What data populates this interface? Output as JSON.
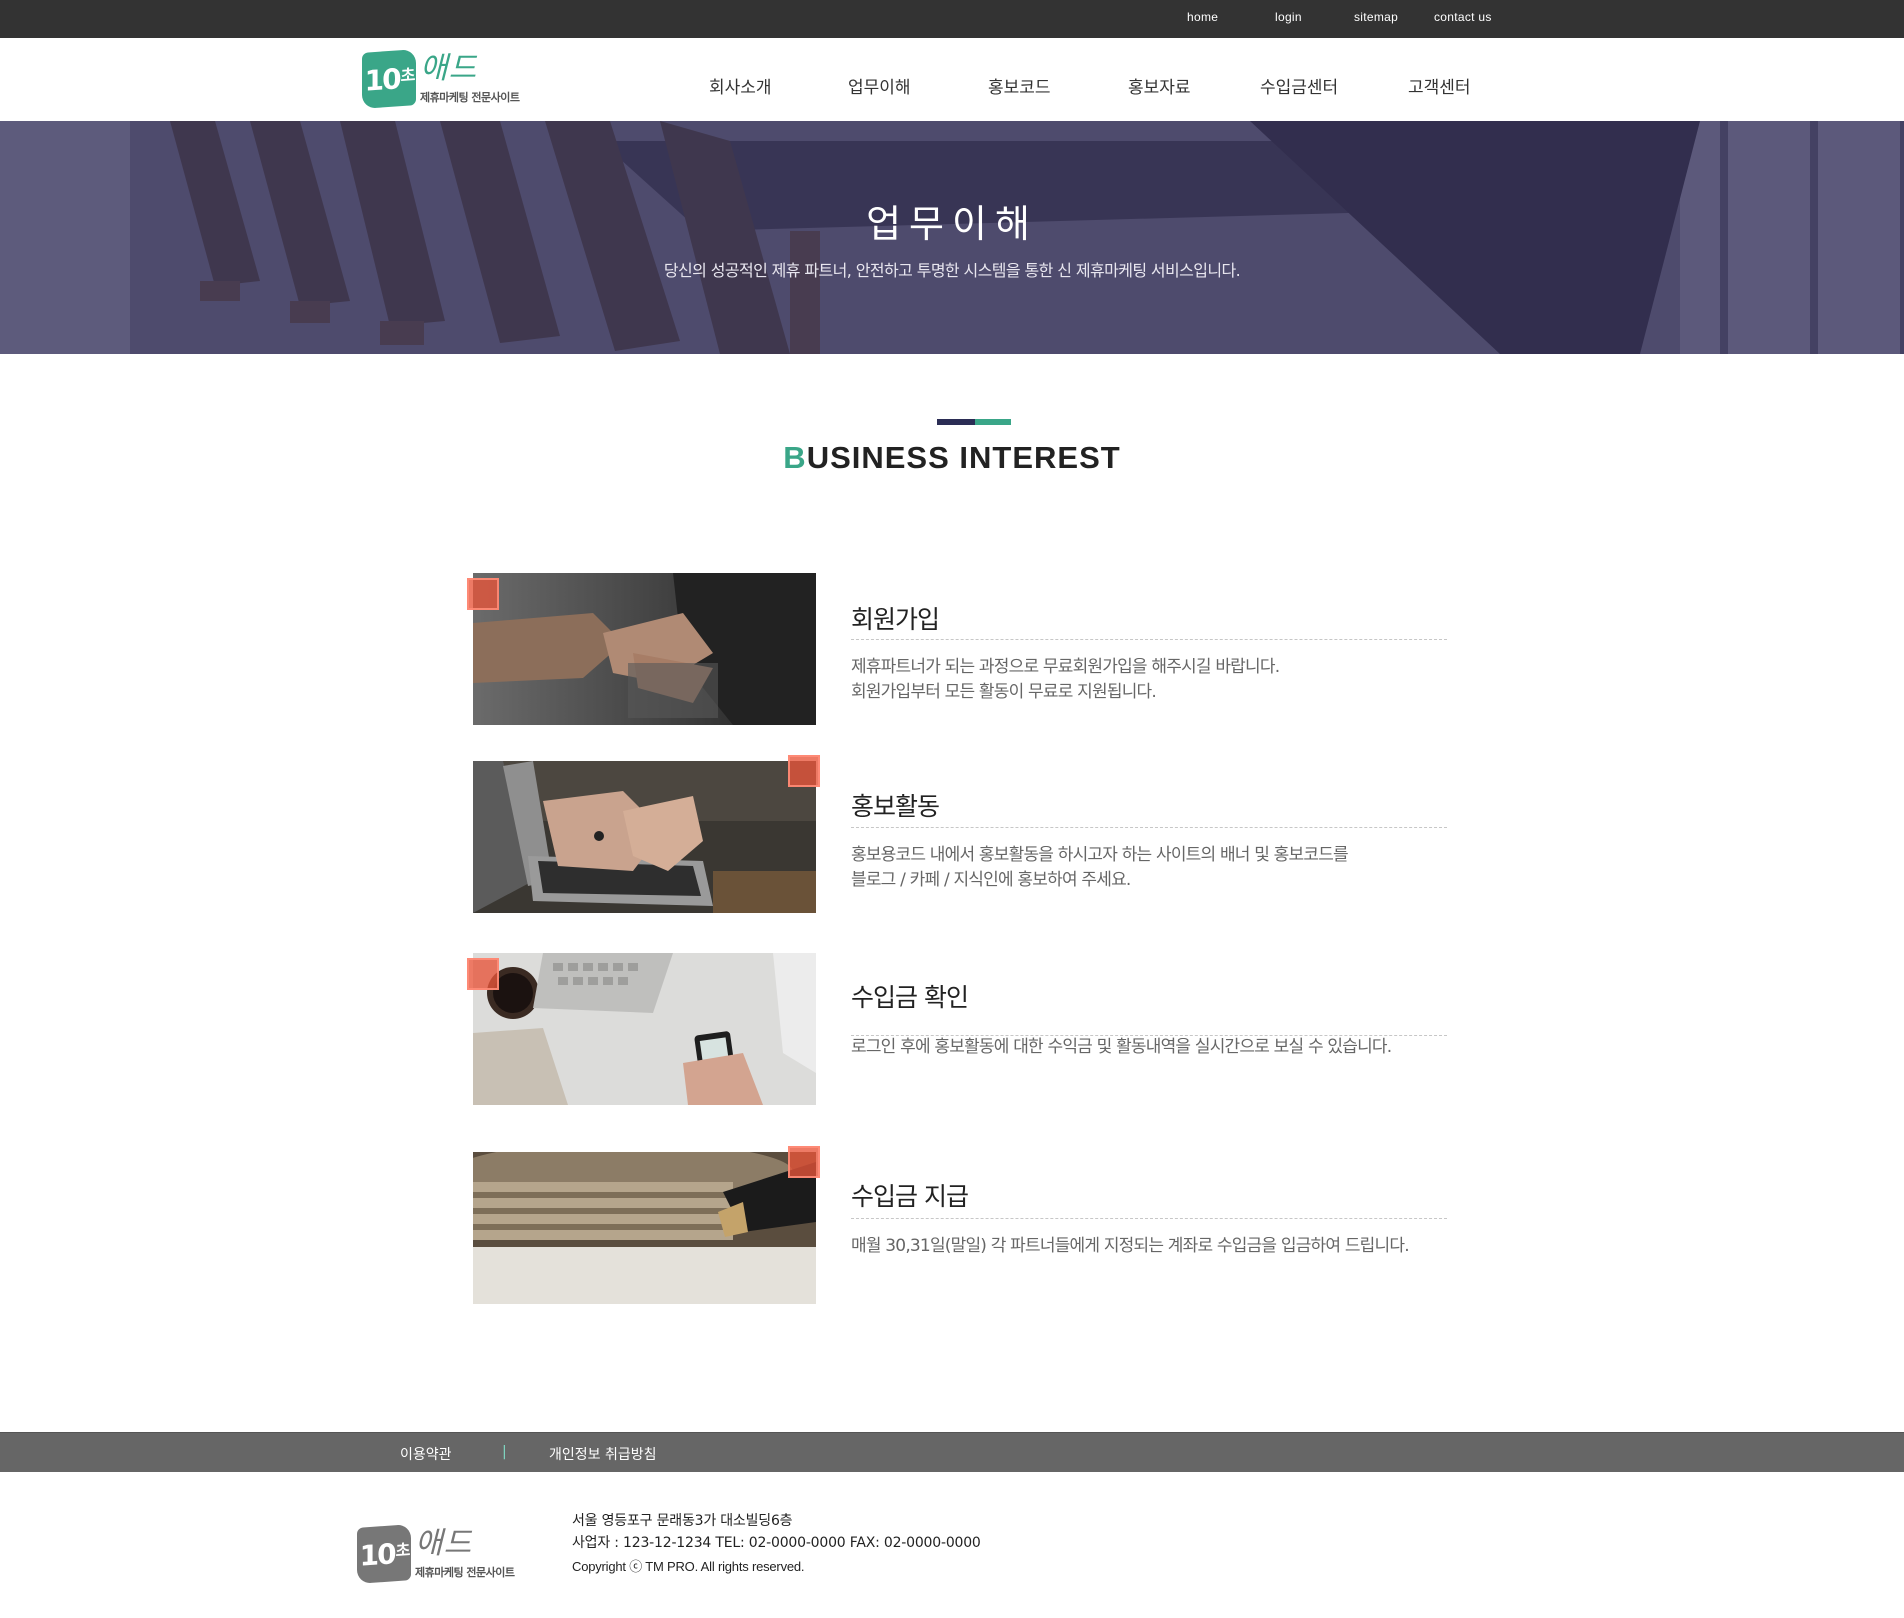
{
  "top_links": [
    "home",
    "login",
    "sitemap",
    "contact us"
  ],
  "brand": {
    "badge": "10",
    "badge_small": "초",
    "wordmark": "애드",
    "tagline": "제휴마케팅 전문사이트"
  },
  "nav": [
    "회사소개",
    "업무이해",
    "홍보코드",
    "홍보자료",
    "수입금센터",
    "고객센터"
  ],
  "hero": {
    "title": "업무이해",
    "subtitle": "당신의 성공적인 제휴 파트너, 안전하고 투명한 시스템을 통한 신 제휴마케팅 서비스입니다."
  },
  "section": {
    "title_accent": "B",
    "title_rest": "USINESS INTEREST"
  },
  "items": [
    {
      "heading": "회원가입",
      "lines": [
        "제휴파트너가 되는 과정으로 무료회원가입을 해주시길 바랍니다.",
        "회원가입부터 모든 활동이 무료로 지원됩니다."
      ],
      "image": "handshake"
    },
    {
      "heading": "홍보활동",
      "lines": [
        "홍보용코드 내에서 홍보활동을 하시고자 하는 사이트의 배너 및 홍보코드를",
        "블로그 / 카페  / 지식인에 홍보하여 주세요."
      ],
      "image": "laptop-typing"
    },
    {
      "heading": "수입금 확인",
      "lines": [
        "로그인 후에 홍보활동에 대한 수익금 및 활동내역을 실시간으로 보실 수 있습니다."
      ],
      "image": "desk-phone"
    },
    {
      "heading": "수입금 지급",
      "lines": [
        "매월 30,31일(말일) 각 파트너들에게 지정되는 계좌로 수입금을 입금하여 드립니다."
      ],
      "image": "coins-pen"
    }
  ],
  "footer": {
    "links": [
      "이용약관",
      "|",
      "개인정보 취급방침"
    ],
    "address": "서울 영등포구 문래동3가 대소빌딩6층",
    "business": "사업자 :  123-12-1234 TEL: 02-0000-0000 FAX: 02-0000-0000",
    "copyright": "Copyright ⓒ TM PRO. All rights reserved."
  },
  "colors": {
    "accent": "#3aa688",
    "navy": "#2b2d55",
    "corner": "#e8543a",
    "topbar": "#333333",
    "footbar": "#666666"
  }
}
